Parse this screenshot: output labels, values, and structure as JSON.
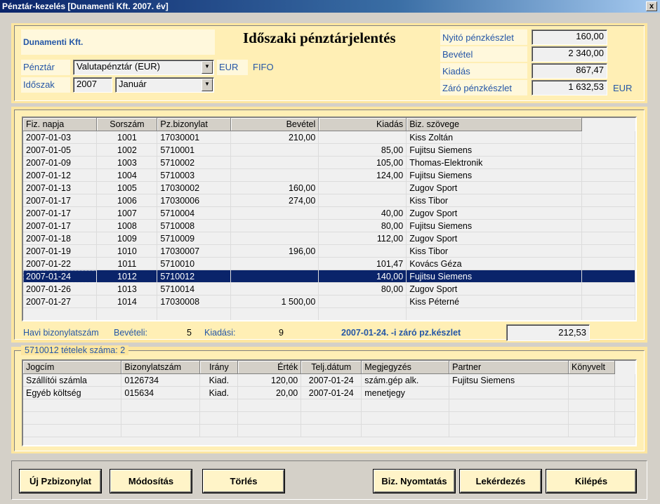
{
  "window": {
    "title": "Pénztár-kezelés  [Dunamenti Kft.   2007. év]",
    "close": "x"
  },
  "header": {
    "company": "Dunamenti Kft.",
    "report_title": "Időszaki pénztárjelentés",
    "penztar_label": "Pénztár",
    "penztar_value": "Valutapénztár  (EUR)",
    "currency": "EUR",
    "method": "FIFO",
    "idoszak_label": "Időszak",
    "year": "2007",
    "month": "Január",
    "nyito_label": "Nyitó pénzkészlet",
    "nyito_value": "160,00",
    "bevetel_label": "Bevétel",
    "bevetel_value": "2 340,00",
    "kiadas_label": "Kiadás",
    "kiadas_value": "867,47",
    "zaro_label": "Záró pénzkészlet",
    "zaro_value": "1 632,53",
    "zaro_currency": "EUR"
  },
  "main_table": {
    "columns": [
      "Fiz. napja",
      "Sorszám",
      "Pz.bizonylat",
      "Bevétel",
      "Kiadás",
      "Biz. szövege"
    ],
    "rows": [
      [
        "2007-01-03",
        "1001",
        "17030001",
        "210,00",
        "",
        "Kiss Zoltán"
      ],
      [
        "2007-01-05",
        "1002",
        "5710001",
        "",
        "85,00",
        "Fujitsu Siemens"
      ],
      [
        "2007-01-09",
        "1003",
        "5710002",
        "",
        "105,00",
        "Thomas-Elektronik"
      ],
      [
        "2007-01-12",
        "1004",
        "5710003",
        "",
        "124,00",
        "Fujitsu Siemens"
      ],
      [
        "2007-01-13",
        "1005",
        "17030002",
        "160,00",
        "",
        "Zugov Sport"
      ],
      [
        "2007-01-17",
        "1006",
        "17030006",
        "274,00",
        "",
        "Kiss Tibor"
      ],
      [
        "2007-01-17",
        "1007",
        "5710004",
        "",
        "40,00",
        "Zugov Sport"
      ],
      [
        "2007-01-17",
        "1008",
        "5710008",
        "",
        "80,00",
        "Fujitsu Siemens"
      ],
      [
        "2007-01-18",
        "1009",
        "5710009",
        "",
        "112,00",
        "Zugov Sport"
      ],
      [
        "2007-01-19",
        "1010",
        "17030007",
        "196,00",
        "",
        "Kiss Tibor"
      ],
      [
        "2007-01-22",
        "1011",
        "5710010",
        "",
        "101,47",
        "Kovács Géza"
      ],
      [
        "2007-01-24",
        "1012",
        "5710012",
        "",
        "140,00",
        "Fujitsu Siemens"
      ],
      [
        "2007-01-26",
        "1013",
        "5710014",
        "",
        "80,00",
        "Zugov Sport"
      ],
      [
        "2007-01-27",
        "1014",
        "17030008",
        "1 500,00",
        "",
        "Kiss Péterné"
      ]
    ],
    "selected_index": 11
  },
  "summary": {
    "havi_label": "Havi bizonylatszám",
    "beveteli_label": "Bevételi:",
    "beveteli_count": "5",
    "kiadasi_label": "Kiadási:",
    "kiadasi_count": "9",
    "date_close_label": "2007-01-24. -i záró pz.készlet",
    "date_close_value": "212,53"
  },
  "detail": {
    "group_label": "5710012  tételek száma: 2",
    "columns": [
      "Jogcím",
      "Bizonylatszám",
      "Irány",
      "Érték",
      "Telj.dátum",
      "Megjegyzés",
      "Partner",
      "Könyvelt"
    ],
    "rows": [
      [
        "Szállítói számla",
        "0126734",
        "Kiad.",
        "120,00",
        "2007-01-24",
        "szám.gép alk.",
        "Fujitsu Siemens",
        ""
      ],
      [
        "Egyéb költség",
        "015634",
        "Kiad.",
        "20,00",
        "2007-01-24",
        "menetjegy",
        "",
        ""
      ]
    ]
  },
  "buttons": {
    "uj": "Új Pzbizonylat",
    "modositas": "Módosítás",
    "torles": "Törlés",
    "nyomtatas": "Biz. Nyomtatás",
    "lekerdezes": "Lekérdezés",
    "kilepes": "Kilépés"
  }
}
